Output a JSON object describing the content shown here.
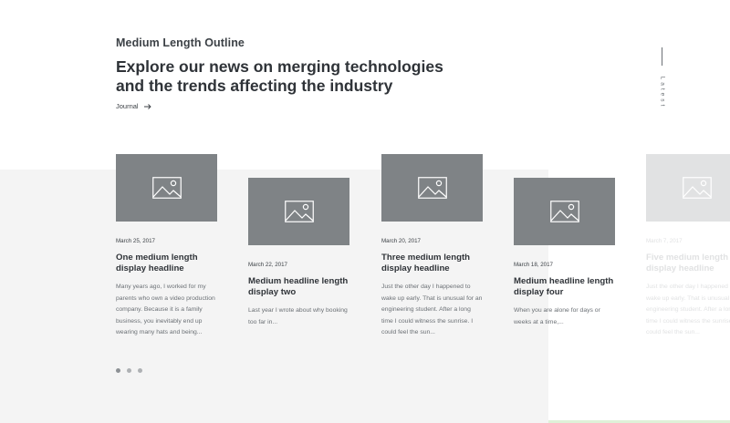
{
  "header": {
    "eyebrow": "Medium Length Outline",
    "headline_line1": "Explore our news on merging technologies",
    "headline_line2": "and the trends affecting the industry",
    "journal_link": "Journal"
  },
  "side_tab": {
    "label": "Latest"
  },
  "colors": {
    "thumbnail": "#7f8386",
    "thumbnail_faded": "#e1e2e3",
    "band": "#f4f4f4",
    "text_dark": "#2f3338",
    "text_muted": "#6b7075"
  },
  "cards": [
    {
      "date": "March 25, 2017",
      "title": "One medium length display headline",
      "excerpt": "Many years ago, I worked for my parents who own a video production company. Because it is a family business, you inevitably end up wearing many hats and being...",
      "icon": "image-placeholder-icon"
    },
    {
      "date": "March 22, 2017",
      "title": "Medium headline length display two",
      "excerpt": "Last year I wrote about why booking too far in...",
      "icon": "image-placeholder-icon"
    },
    {
      "date": "March 20, 2017",
      "title": "Three medium length display headline",
      "excerpt": "Just the other day I happened to wake up early. That is unusual for an engineering student. After a long time I could witness the sunrise. I could feel the sun...",
      "icon": "image-placeholder-icon"
    },
    {
      "date": "March 18, 2017",
      "title": "Medium headline length display four",
      "excerpt": "When you are alone for days or weeks at a time,...",
      "icon": "image-placeholder-icon"
    },
    {
      "date": "March 7, 2017",
      "title": "Five medium length display headline",
      "excerpt": "Just the other day I happened to wake up early. That is unusual for an engineering student. After a long time I could witness the sunrise. I could feel the sun...",
      "icon": "image-placeholder-icon"
    }
  ],
  "pagination": {
    "count": 3,
    "active": 0
  }
}
